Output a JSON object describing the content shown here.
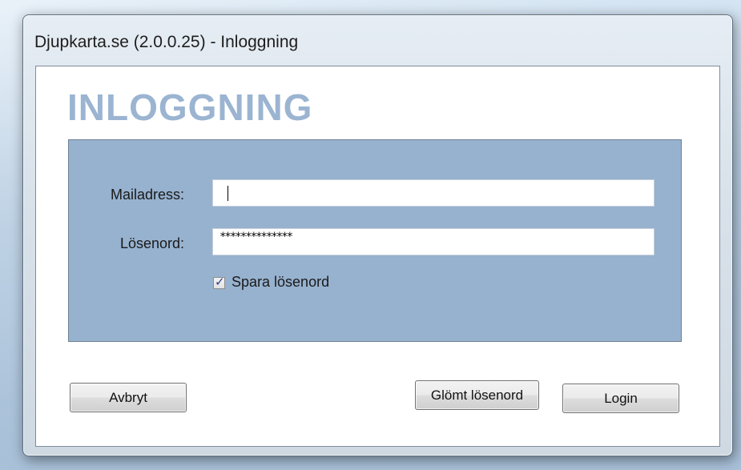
{
  "window": {
    "title": "Djupkarta.se (2.0.0.25) - Inloggning"
  },
  "form": {
    "heading": "INLOGGNING",
    "email_label": "Mailadress:",
    "email_value": "",
    "password_label": "Lösenord:",
    "password_value": "**************",
    "save_password_label": "Spara lösenord",
    "save_password_checked": true
  },
  "buttons": {
    "cancel": "Avbryt",
    "forgot": "Glömt lösenord",
    "login": "Login"
  },
  "colors": {
    "heading": "#9bb4d1",
    "panel": "#97b2cf"
  }
}
